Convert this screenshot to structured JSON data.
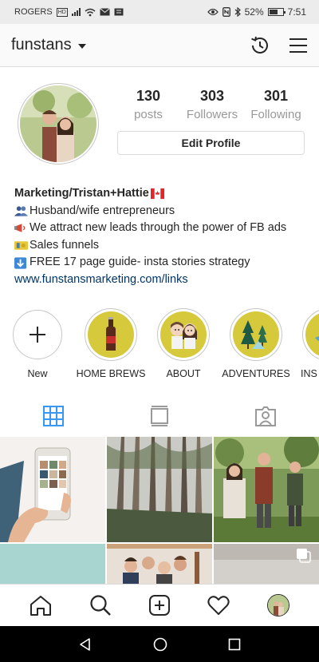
{
  "status_bar": {
    "carrier": "ROGERS",
    "hd_badge": "HD",
    "battery": "52%",
    "time": "7:51"
  },
  "header": {
    "username": "funstans"
  },
  "profile": {
    "stats": [
      {
        "value": "130",
        "label": "posts"
      },
      {
        "value": "303",
        "label": "Followers"
      },
      {
        "value": "301",
        "label": "Following"
      }
    ],
    "edit_label": "Edit Profile"
  },
  "bio": {
    "name": "Marketing/Tristan+Hattie",
    "lines": [
      "Husband/wife entrepreneurs",
      "We attract new leads through the power of FB ads",
      "Sales funnels",
      "FREE 17 page guide- insta stories strategy"
    ],
    "link": "www.funstansmarketing.com/links"
  },
  "highlights": [
    {
      "label": "New",
      "icon": "plus-icon"
    },
    {
      "label": "HOME BREWS",
      "icon": "beer-bottle-icon"
    },
    {
      "label": "ABOUT",
      "icon": "couple-icon"
    },
    {
      "label": "ADVENTURES",
      "icon": "trees-icon"
    },
    {
      "label": "INS",
      "icon": "hat-icon"
    }
  ],
  "tabs": [
    {
      "name": "grid",
      "icon": "grid-icon",
      "active": true
    },
    {
      "name": "feed",
      "icon": "feed-icon",
      "active": false
    },
    {
      "name": "tagged",
      "icon": "tagged-icon",
      "active": false
    }
  ],
  "colors": {
    "accent_blue": "#3897f0",
    "highlight_yellow": "#d6c93b",
    "link": "#003569"
  }
}
